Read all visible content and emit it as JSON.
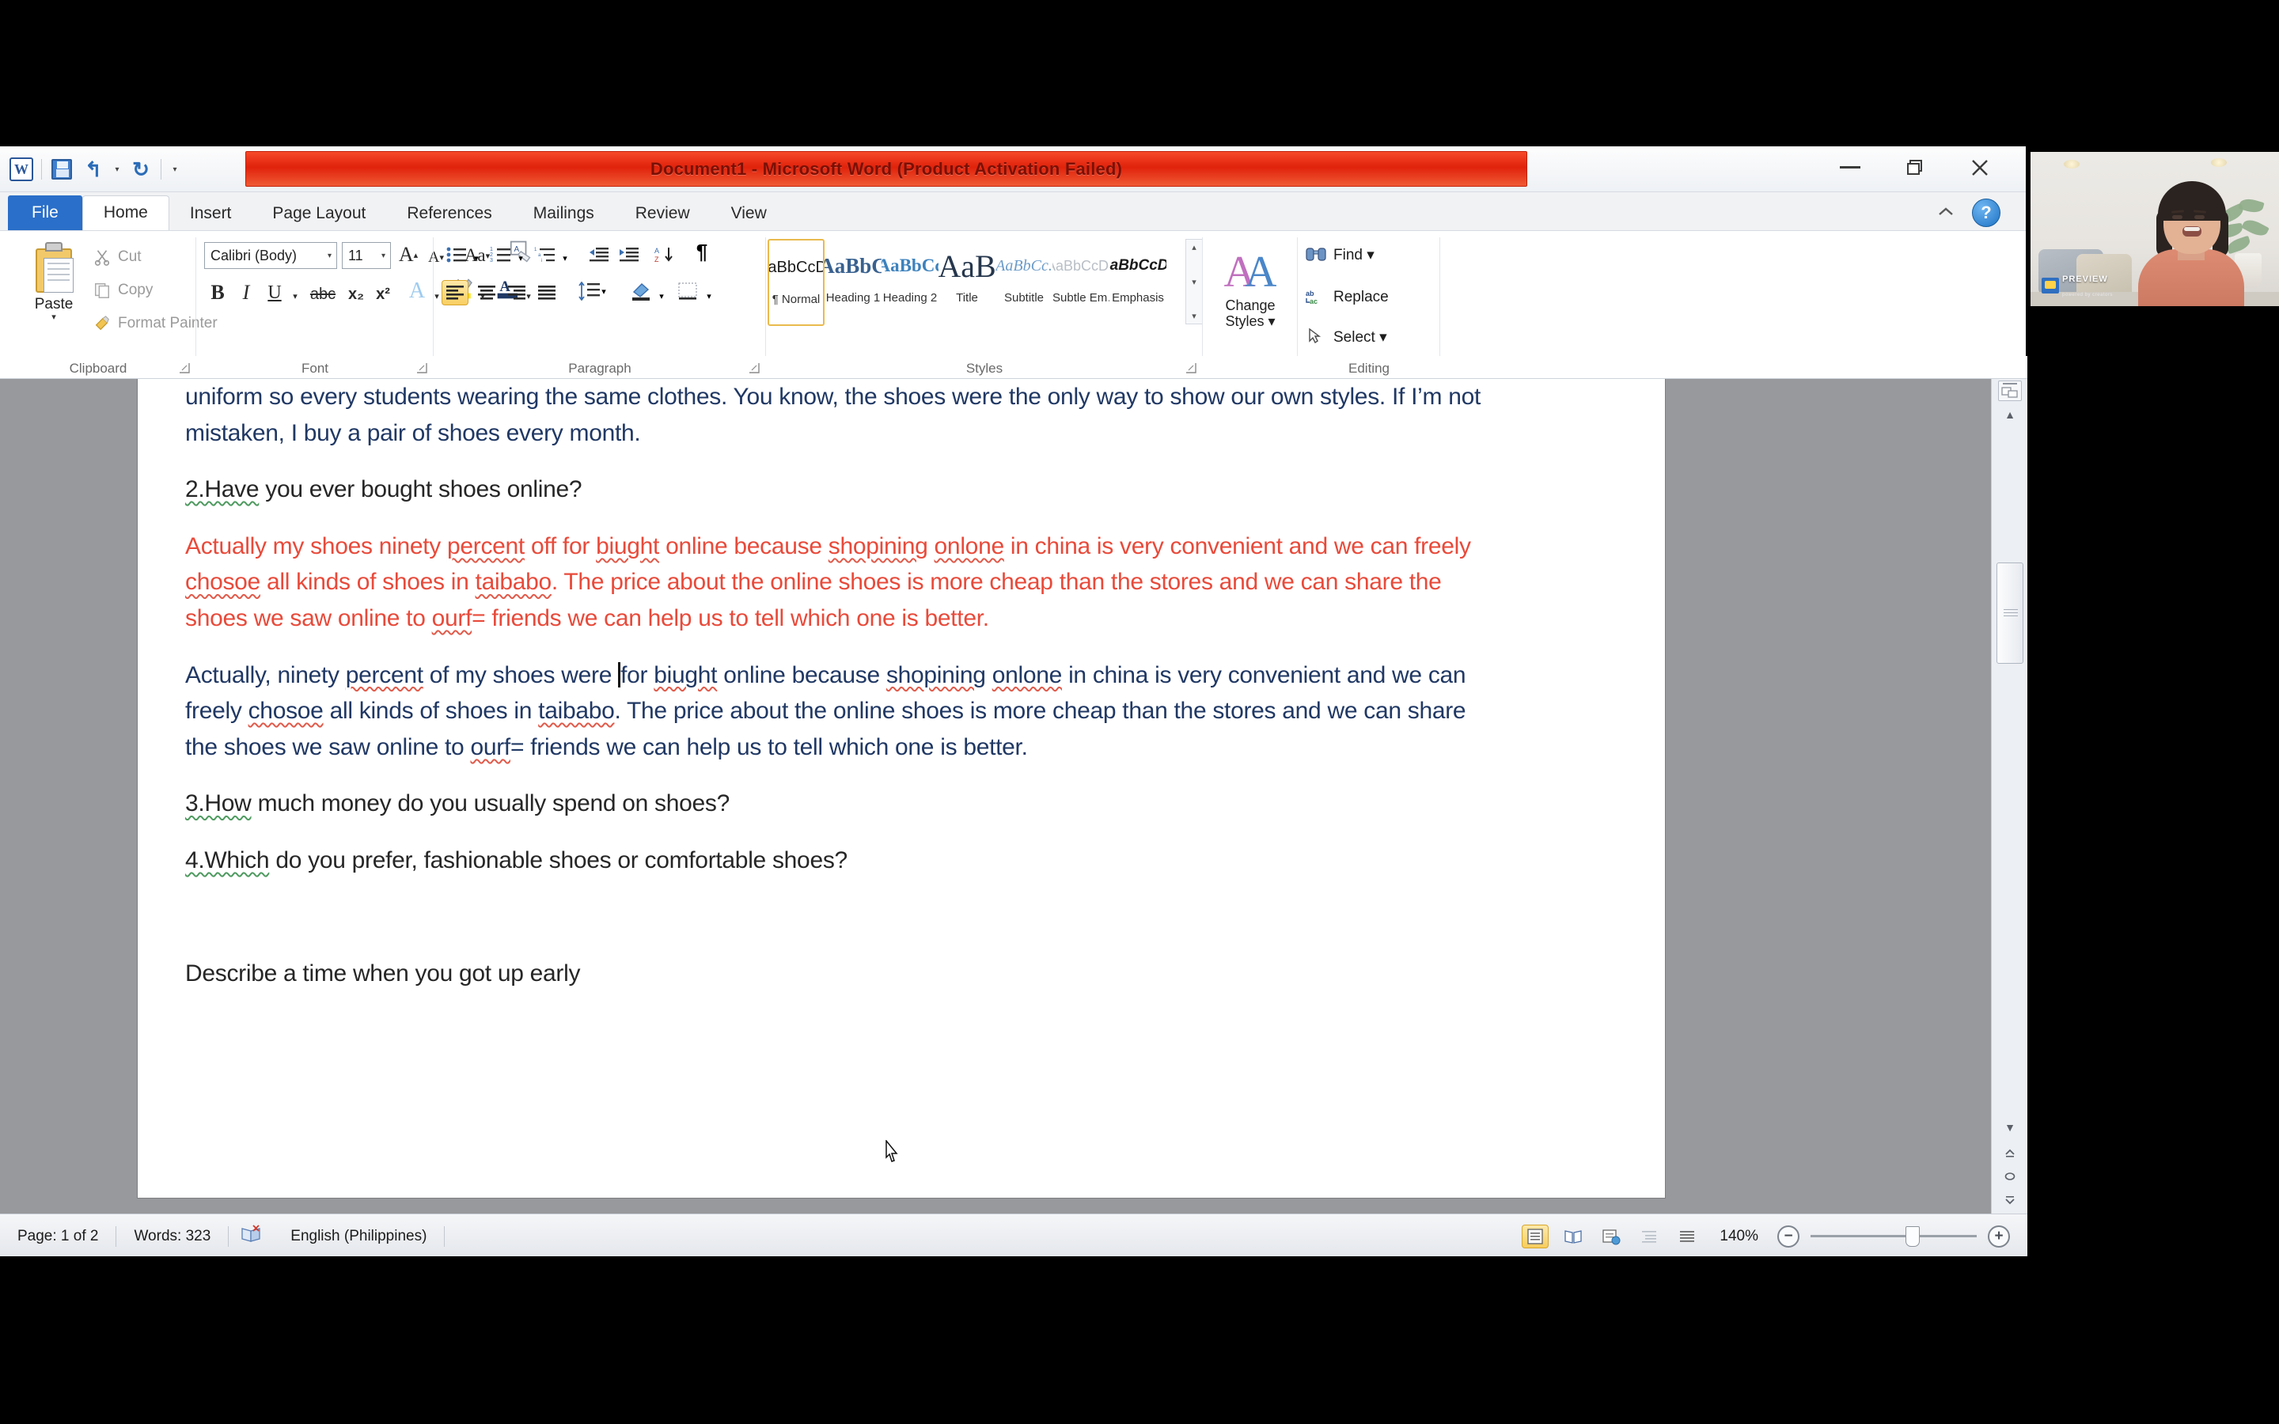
{
  "window": {
    "title": "Document1  -  Microsoft Word (Product Activation Failed)",
    "minimize": "–",
    "restore": "restore-icon",
    "close": "×"
  },
  "quick_access": {
    "word_logo": "W",
    "save": "save-icon",
    "undo": "undo-icon",
    "redo": "redo-icon",
    "customize": "customize-icon"
  },
  "tabs": [
    {
      "label": "File",
      "active": false,
      "kind": "file"
    },
    {
      "label": "Home",
      "active": true,
      "kind": "normal"
    },
    {
      "label": "Insert",
      "active": false,
      "kind": "normal"
    },
    {
      "label": "Page Layout",
      "active": false,
      "kind": "normal"
    },
    {
      "label": "References",
      "active": false,
      "kind": "normal"
    },
    {
      "label": "Mailings",
      "active": false,
      "kind": "normal"
    },
    {
      "label": "Review",
      "active": false,
      "kind": "normal"
    },
    {
      "label": "View",
      "active": false,
      "kind": "normal"
    }
  ],
  "ribbon_chrome": {
    "collapse_ribbon": "chevron-up-icon",
    "help": "?"
  },
  "ribbon": {
    "clipboard": {
      "label": "Clipboard",
      "paste": "Paste",
      "paste_arrow": "▾",
      "cut": "Cut",
      "copy": "Copy",
      "format_painter": "Format Painter",
      "dialog_launcher": "▣"
    },
    "font": {
      "label": "Font",
      "font_name": "Calibri (Body)",
      "font_size": "11",
      "grow_font": "A",
      "shrink_font": "A",
      "change_case": "Aa",
      "clear_formatting": "clear-formatting-icon",
      "bold": "B",
      "italic": "I",
      "underline": "U",
      "strikethrough": "abc",
      "subscript": "x₂",
      "superscript": "x²",
      "text_effects": "A",
      "highlight": "ab",
      "font_color": "A",
      "dialog_launcher": "▣"
    },
    "paragraph": {
      "label": "Paragraph",
      "bullets": "bullets-icon",
      "numbering": "numbering-icon",
      "multilevel": "multilevel-list-icon",
      "decrease_indent": "decrease-indent-icon",
      "increase_indent": "increase-indent-icon",
      "sort": "sort-icon",
      "show_marks": "¶",
      "align_left": "align-left-icon",
      "align_center": "align-center-icon",
      "align_right": "align-right-icon",
      "justify": "justify-icon",
      "line_spacing": "line-spacing-icon",
      "shading": "shading-icon",
      "borders": "borders-icon",
      "dialog_launcher": "▣",
      "selected_alignment": "align_left"
    },
    "styles": {
      "label": "Styles",
      "items": [
        {
          "preview": "AaBbCcDc",
          "name": "¶ Normal",
          "selected": true
        },
        {
          "preview": "AaBbC",
          "name": "Heading 1",
          "selected": false
        },
        {
          "preview": "AaBbCc",
          "name": "Heading 2",
          "selected": false
        },
        {
          "preview": "AaB",
          "name": "Title",
          "selected": false
        },
        {
          "preview": "AaBbCc.",
          "name": "Subtitle",
          "selected": false
        },
        {
          "preview": "AaBbCcDc",
          "name": "Subtle Em…",
          "selected": false
        },
        {
          "preview": "AaBbCcDc",
          "name": "Emphasis",
          "selected": false
        }
      ],
      "scroll_up": "▴",
      "scroll_down": "▾",
      "more": "▾",
      "dialog_launcher": "▣"
    },
    "change_styles": {
      "line1": "Change",
      "line2": "Styles ▾",
      "icon": "AA"
    },
    "editing": {
      "label": "Editing",
      "find": "Find ▾",
      "replace": "Replace",
      "select": "Select ▾"
    }
  },
  "document": {
    "paragraphs": [
      {
        "color": "blue",
        "runs": [
          {
            "t": "uniform so every students wearing the same clothes. You know, the shoes were the only way to show our own styles. If I’m not mistaken, I buy a pair of shoes every month.",
            "sq": "none"
          }
        ]
      },
      {
        "color": "dark",
        "runs": [
          {
            "t": "2.Have",
            "sq": "green"
          },
          {
            "t": " you ever bought shoes online?",
            "sq": "none"
          }
        ]
      },
      {
        "color": "red",
        "runs": [
          {
            "t": "Actually my shoes ninety ",
            "sq": "none"
          },
          {
            "t": "percent",
            "sq": "red"
          },
          {
            "t": " off for ",
            "sq": "none"
          },
          {
            "t": "biught",
            "sq": "red"
          },
          {
            "t": " online because ",
            "sq": "none"
          },
          {
            "t": "shopining",
            "sq": "red"
          },
          {
            "t": " ",
            "sq": "none"
          },
          {
            "t": "onlone",
            "sq": "red"
          },
          {
            "t": " in china is very convenient and we can freely ",
            "sq": "none"
          },
          {
            "t": "chosoe",
            "sq": "red"
          },
          {
            "t": " all kinds of shoes in ",
            "sq": "none"
          },
          {
            "t": "taibabo",
            "sq": "red"
          },
          {
            "t": ". The price about the online shoes is more cheap than the stores and we can share the shoes we saw online to ",
            "sq": "none"
          },
          {
            "t": "ourf",
            "sq": "red"
          },
          {
            "t": "= friends we can help us to tell which one is better.",
            "sq": "none"
          }
        ]
      },
      {
        "color": "blue",
        "runs": [
          {
            "t": "Actually, ninety ",
            "sq": "none"
          },
          {
            "t": "percent",
            "sq": "red"
          },
          {
            "t": " of my shoes were ",
            "sq": "none"
          },
          {
            "t": "CARET",
            "sq": "caret"
          },
          {
            "t": "for ",
            "sq": "none"
          },
          {
            "t": "biught",
            "sq": "red"
          },
          {
            "t": " online because ",
            "sq": "none"
          },
          {
            "t": "shopining",
            "sq": "red"
          },
          {
            "t": " ",
            "sq": "none"
          },
          {
            "t": "onlone",
            "sq": "red"
          },
          {
            "t": " in china is very convenient and we can freely ",
            "sq": "none"
          },
          {
            "t": "chosoe",
            "sq": "red"
          },
          {
            "t": " all kinds of shoes in ",
            "sq": "none"
          },
          {
            "t": "taibabo",
            "sq": "red"
          },
          {
            "t": ". The price about the online shoes is more cheap than the stores and we can share the shoes we saw online to ",
            "sq": "none"
          },
          {
            "t": "ourf",
            "sq": "red"
          },
          {
            "t": "= friends we can help us to tell which one is better.",
            "sq": "none"
          }
        ]
      },
      {
        "color": "dark",
        "runs": [
          {
            "t": "3.How",
            "sq": "green"
          },
          {
            "t": " much money do you usually spend on shoes?",
            "sq": "none"
          }
        ]
      },
      {
        "color": "dark",
        "runs": [
          {
            "t": "4.Which",
            "sq": "green"
          },
          {
            "t": " do you prefer, fashionable shoes or comfortable shoes?",
            "sq": "none"
          }
        ]
      },
      {
        "color": "dark",
        "runs": [
          {
            "t": "",
            "sq": "none"
          }
        ]
      },
      {
        "color": "dark",
        "runs": [
          {
            "t": "Describe a time when you got up early",
            "sq": "none"
          }
        ]
      }
    ]
  },
  "scrollbar": {
    "select_browse_object": "select-browse-object-icon",
    "up": "▲",
    "down": "▼",
    "prev_page": "prev-page-icon",
    "browse": "browse-icon",
    "next_page": "next-page-icon"
  },
  "status_bar": {
    "page": "Page: 1 of 2",
    "words": "Words: 323",
    "proofing_icon": "proofing-errors-icon",
    "language": "English (Philippines)",
    "views": [
      {
        "name": "print-layout",
        "glyph": "print-layout-icon",
        "selected": true
      },
      {
        "name": "full-screen-reading",
        "glyph": "reading-view-icon",
        "selected": false
      },
      {
        "name": "web-layout",
        "glyph": "web-layout-icon",
        "selected": false
      },
      {
        "name": "outline",
        "glyph": "outline-icon",
        "selected": false
      },
      {
        "name": "draft",
        "glyph": "draft-icon",
        "selected": false
      }
    ],
    "zoom_level": "140%",
    "zoom_out": "−",
    "zoom_in": "+"
  },
  "webcam": {
    "brand": "PREVIEW",
    "brand_sub": "powered by creators"
  },
  "colors": {
    "title_red": "#e0220b",
    "file_tab_blue": "#2a6fc9",
    "doc_blue_text": "#203864",
    "doc_red_text": "#e84a3a",
    "spell_red": "#e05a4a",
    "grammar_green": "#4e9a5f",
    "style_highlight": "#e9ba4d"
  }
}
